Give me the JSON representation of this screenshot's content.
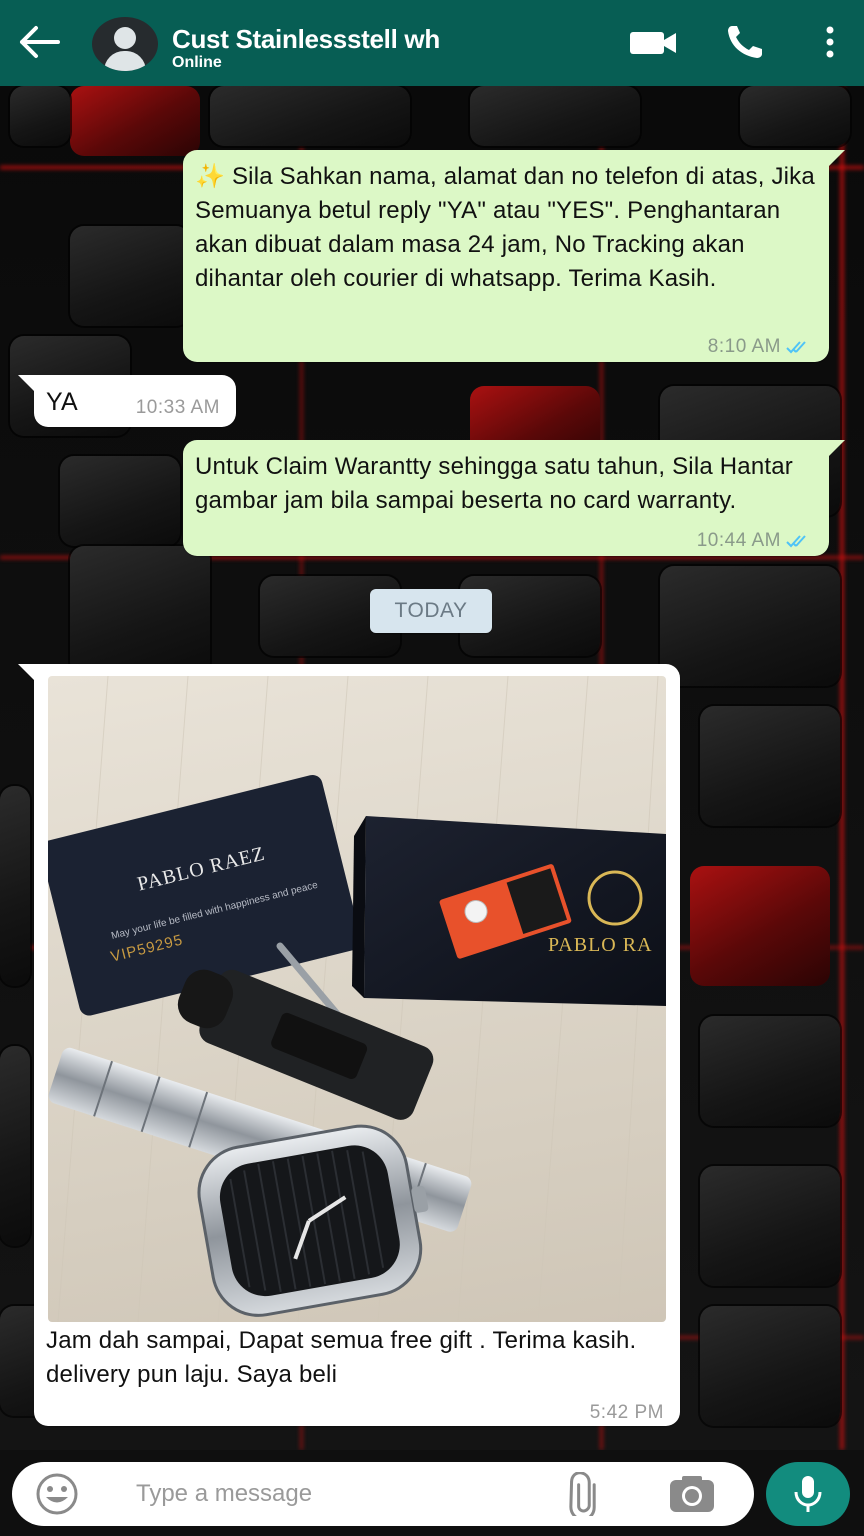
{
  "header": {
    "contact_name": "Cust Stainlessstell wh",
    "status": "Online",
    "icons": [
      "back-arrow-icon",
      "video-call-icon",
      "voice-call-icon",
      "more-menu-icon"
    ]
  },
  "messages": [
    {
      "direction": "outgoing",
      "emoji": "✨",
      "text": "Sila Sahkan nama, alamat dan no telefon di atas, Jika Semuanya betul reply \"YA\" atau \"YES\". Penghantaran akan dibuat dalam masa 24 jam, No Tracking akan dihantar oleh courier di whatsapp. Terima Kasih.",
      "time": "8:10 AM",
      "status": "read"
    },
    {
      "direction": "incoming",
      "text": "YA",
      "time": "10:33 AM"
    },
    {
      "direction": "outgoing",
      "text": "Untuk Claim Warantty sehingga satu tahun, Sila Hantar gambar jam bila sampai beserta no card warranty.",
      "time": "10:44 AM",
      "status": "read"
    },
    {
      "direction": "incoming",
      "type": "image",
      "image_content": {
        "card_brand": "PABLO RAEZ",
        "card_tagline": "May your life be filled with happiness and peace",
        "card_number": "VIP59295",
        "box_brand": "PABLO RA"
      },
      "caption": "Jam dah sampai, Dapat semua free gift . Terima kasih. delivery pun laju. Saya beli",
      "time": "5:42 PM"
    }
  ],
  "date_divider": "TODAY",
  "composer": {
    "placeholder": "Type a message"
  },
  "colors": {
    "header": "#075e54",
    "outgoing_bubble": "#dcf8c6",
    "incoming_bubble": "#ffffff",
    "read_ticks": "#4fc3f7",
    "mic_button": "#128c7e"
  }
}
